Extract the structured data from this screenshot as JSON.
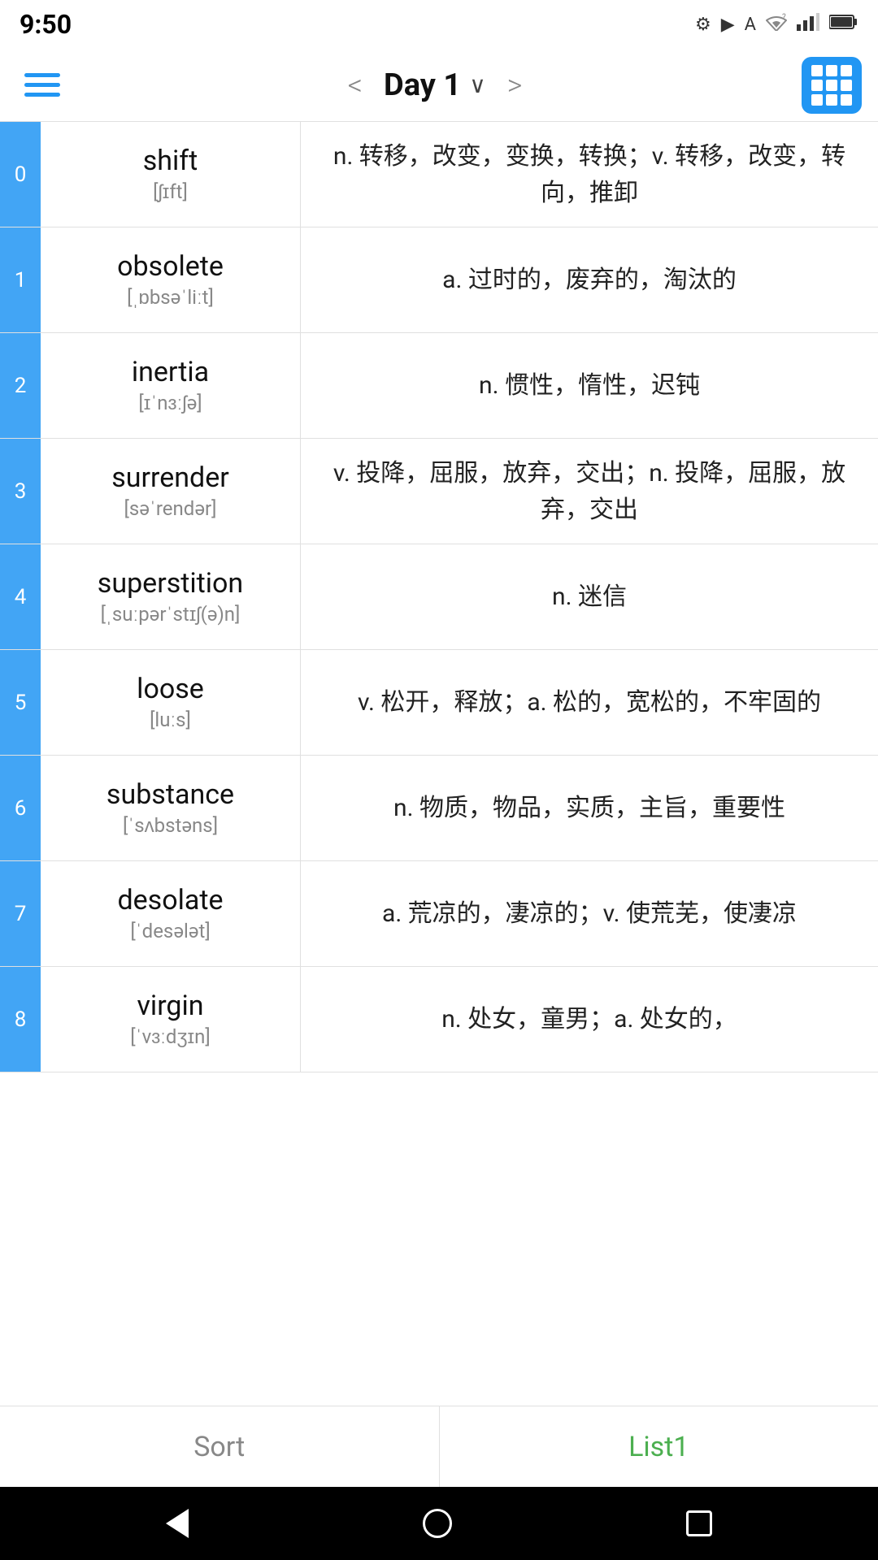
{
  "statusBar": {
    "time": "9:50",
    "icons": [
      "gear",
      "play",
      "font",
      "wifi",
      "signal",
      "battery"
    ]
  },
  "header": {
    "title": "Day 1",
    "prevLabel": "<",
    "nextLabel": ">"
  },
  "words": [
    {
      "index": "0",
      "english": "shift",
      "phonetic": "[ʃɪft]",
      "definition": "n. 转移，改变，变换，转换；v. 转移，改变，转向，推卸"
    },
    {
      "index": "1",
      "english": "obsolete",
      "phonetic": "[ˌɒbsəˈliːt]",
      "definition": "a. 过时的，废弃的，淘汰的"
    },
    {
      "index": "2",
      "english": "inertia",
      "phonetic": "[ɪˈnɜːʃə]",
      "definition": "n. 惯性，惰性，迟钝"
    },
    {
      "index": "3",
      "english": "surrender",
      "phonetic": "[səˈrendər]",
      "definition": "v. 投降，屈服，放弃，交出；n. 投降，屈服，放弃，交出"
    },
    {
      "index": "4",
      "english": "superstition",
      "phonetic": "[ˌsuːpərˈstɪʃ(ə)n]",
      "definition": "n. 迷信"
    },
    {
      "index": "5",
      "english": "loose",
      "phonetic": "[luːs]",
      "definition": "v. 松开，释放；a. 松的，宽松的，不牢固的"
    },
    {
      "index": "6",
      "english": "substance",
      "phonetic": "[ˈsʌbstəns]",
      "definition": "n. 物质，物品，实质，主旨，重要性"
    },
    {
      "index": "7",
      "english": "desolate",
      "phonetic": "[ˈdesələt]",
      "definition": "a. 荒凉的，凄凉的；v. 使荒芜，使凄凉"
    },
    {
      "index": "8",
      "english": "virgin",
      "phonetic": "[ˈvɜːdʒɪn]",
      "definition": "n. 处女，童男；a. 处女的，"
    }
  ],
  "bottomTabs": {
    "sort": "Sort",
    "list1": "List1"
  },
  "androidNav": {
    "back": "back",
    "home": "home",
    "recent": "recent"
  }
}
